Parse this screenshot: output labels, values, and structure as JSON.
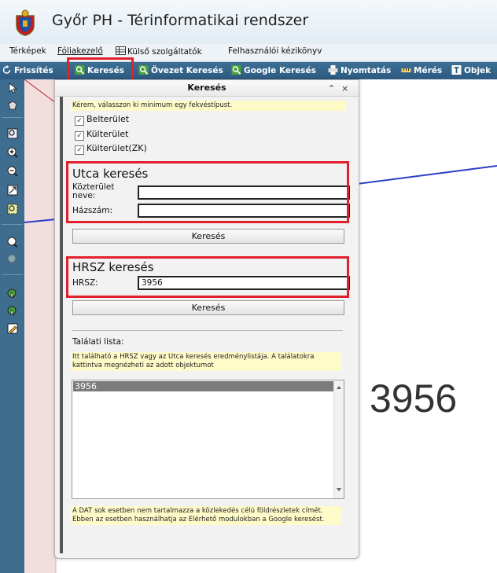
{
  "app": {
    "title": "Győr PH - Térinformatikai rendszer"
  },
  "menu": {
    "items": [
      "Térképek",
      "Fóliakezelő",
      "Külső szolgáltatók",
      "Felhasználói kézikönyv"
    ]
  },
  "toolbar": {
    "refresh": "Frissítés",
    "search": "Keresés",
    "zone_search": "Övezet Keresés",
    "google_search": "Google Keresés",
    "print": "Nyomtatás",
    "measure": "Mérés",
    "objects": "Objek"
  },
  "panel": {
    "title": "Keresés",
    "collapse_icon": "«",
    "close_icon": "×",
    "notice": "Kérem, válasszon ki minimum egy fekvéstípust.",
    "checkboxes": [
      {
        "label": "Belterület",
        "checked": true
      },
      {
        "label": "Külterület",
        "checked": true
      },
      {
        "label": "Külterület(ZK)",
        "checked": true
      }
    ],
    "street": {
      "title": "Utca keresés",
      "street_label": "Közterület neve:",
      "street_value": "",
      "house_label": "Házszám:",
      "house_value": "",
      "button": "Keresés"
    },
    "hrsz": {
      "title": "HRSZ keresés",
      "label": "HRSZ:",
      "value": "3956",
      "button": "Keresés"
    },
    "results": {
      "title": "Találati lista:",
      "hint": "Itt található a HRSZ vagy az Utca keresés eredménylistája. A találatokra kattintva megnézheti az adott objektumot",
      "items": [
        "3956"
      ],
      "footer": "A DAT sok esetben nem tartalmazza a közlekedés célú földrészletek címét. Ebben az esetben használhatja az Elérhető modulokban a Google keresést."
    }
  },
  "map": {
    "label": "3956"
  },
  "colors": {
    "highlight": "#e0202b",
    "toolbar": "#2c5a80",
    "map_line": "#2a3fc9"
  }
}
